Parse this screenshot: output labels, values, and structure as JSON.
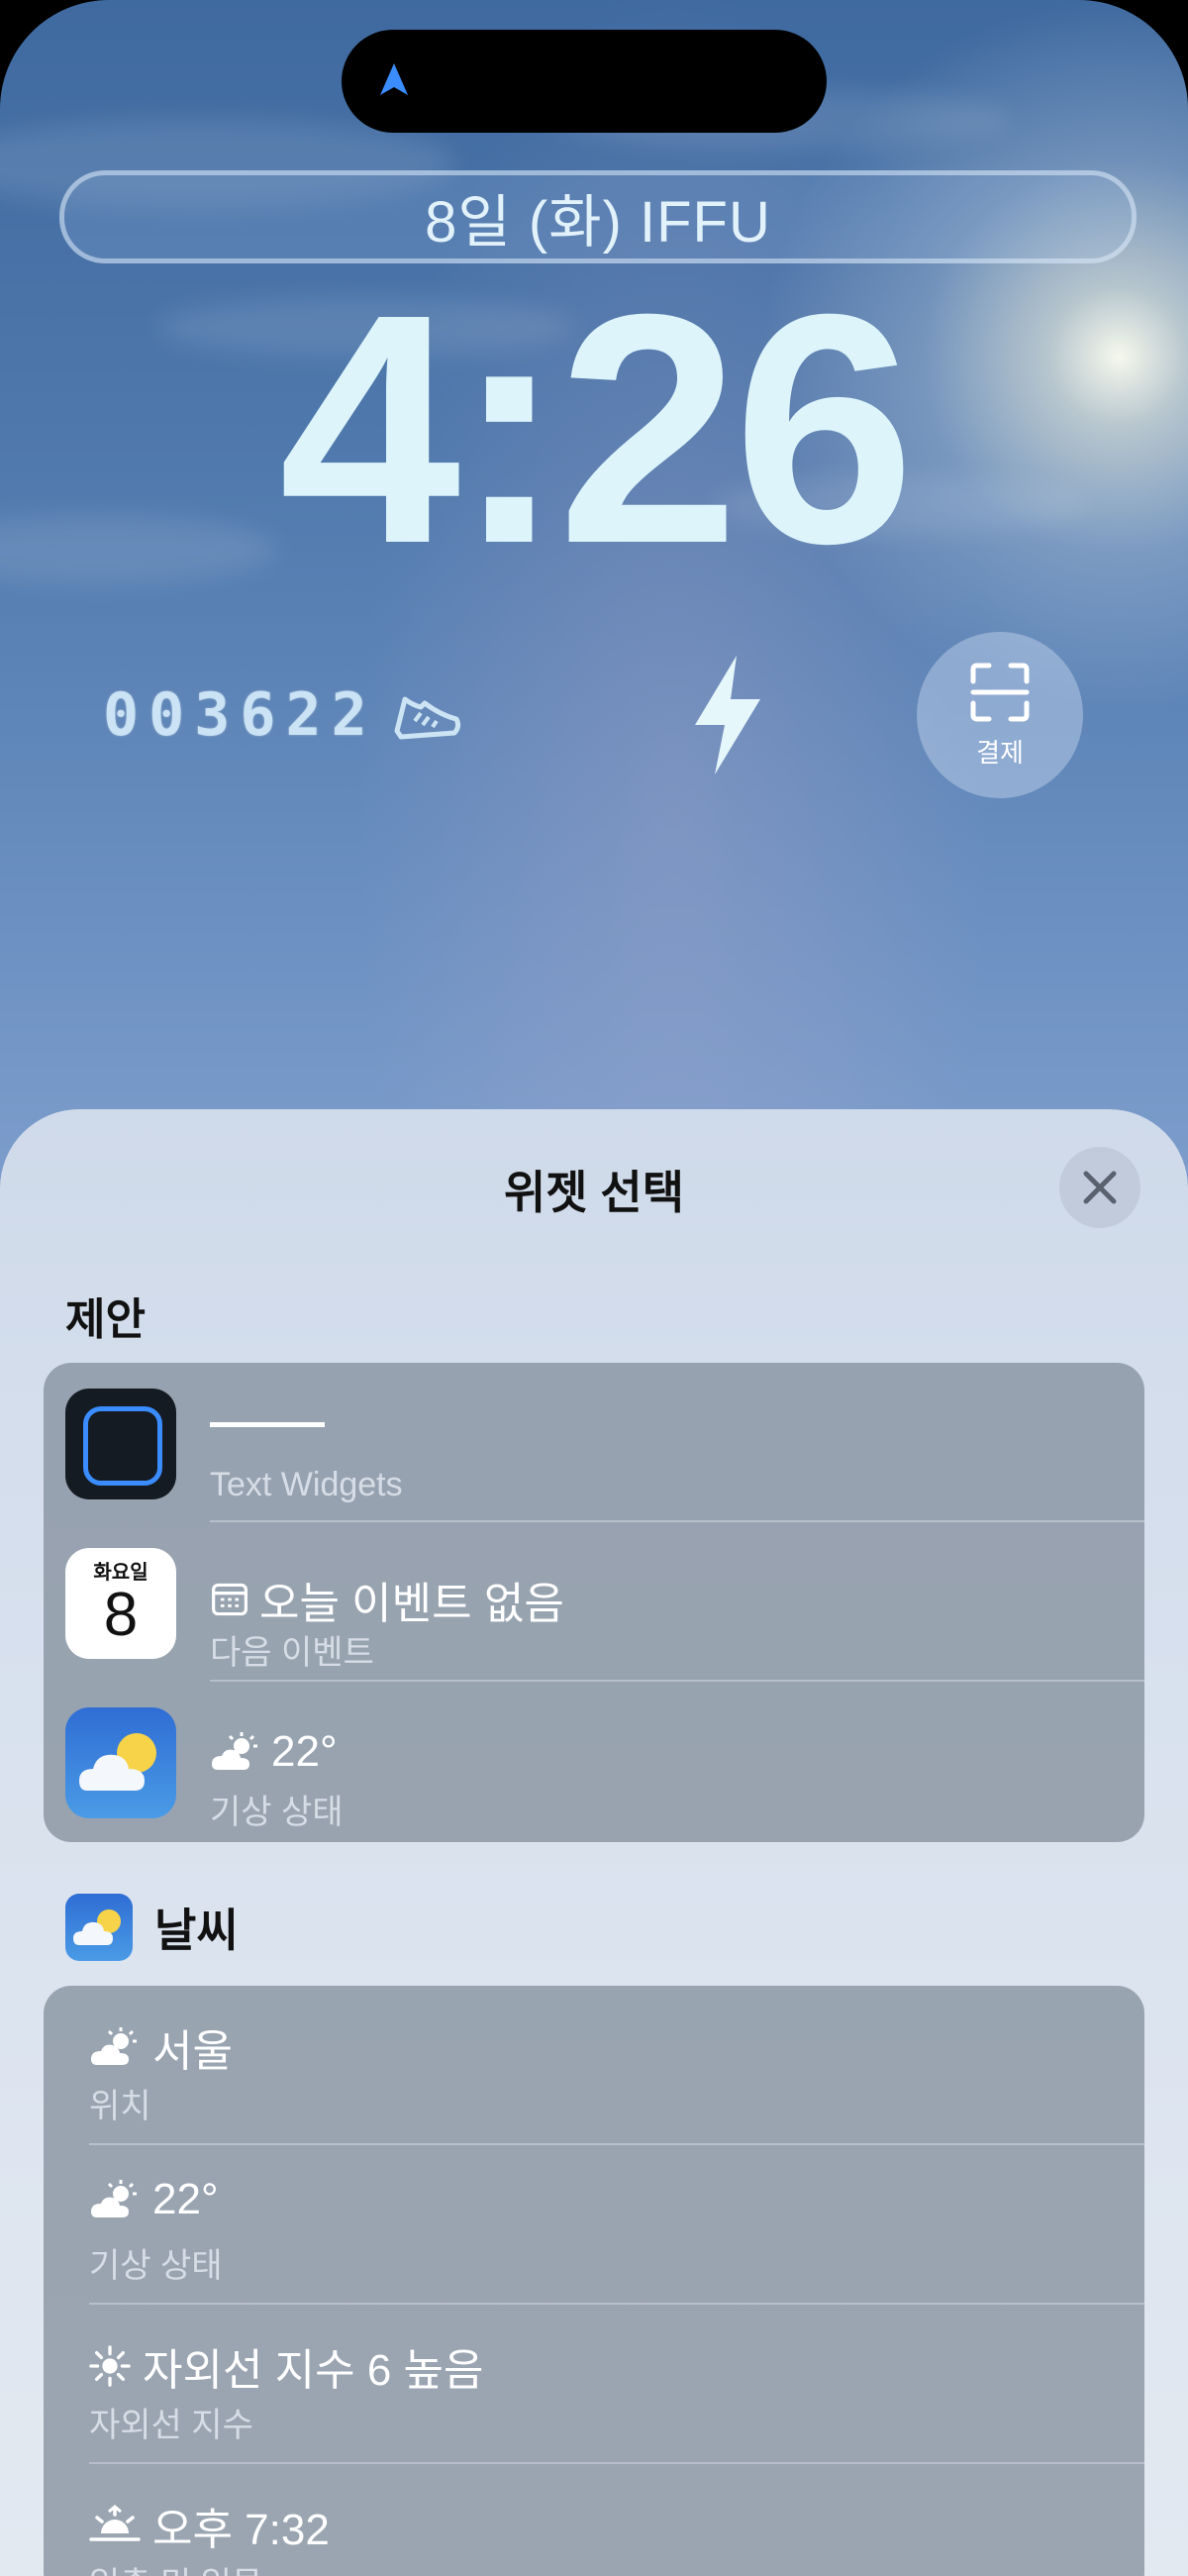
{
  "lock_screen": {
    "date_line": "8일 (화)  IFFU",
    "time": "4:26",
    "steps_digits": "003622",
    "pay_label": "결제"
  },
  "icons": {
    "location": "location-arrow-icon",
    "shoe": "sneaker-icon",
    "bolt": "lightning-bolt-icon",
    "pay": "scan-icon",
    "close": "close-icon"
  },
  "sheet": {
    "title": "위젯 선택",
    "suggestions_header": "제안",
    "suggestions": [
      {
        "app": "Text Widgets",
        "title": "",
        "subtitle": "Text Widgets"
      },
      {
        "calendar_dow": "화요일",
        "calendar_day": "8",
        "title": "오늘 이벤트 없음",
        "subtitle": "다음 이벤트"
      },
      {
        "title": "22°",
        "subtitle": "기상 상태"
      }
    ],
    "weather_header": "날씨",
    "weather_items": [
      {
        "title": "서울",
        "subtitle": "위치"
      },
      {
        "title": "22°",
        "subtitle": "기상 상태"
      },
      {
        "title": "자외선 지수 6 높음",
        "subtitle": "자외선 지수"
      },
      {
        "title": "오후 7:32",
        "subtitle": "일출 및 일몰"
      }
    ]
  },
  "colors": {
    "accent_blue": "#3a8cff",
    "clock_text": "#dcf4fa",
    "card_bg": "#808a98"
  }
}
